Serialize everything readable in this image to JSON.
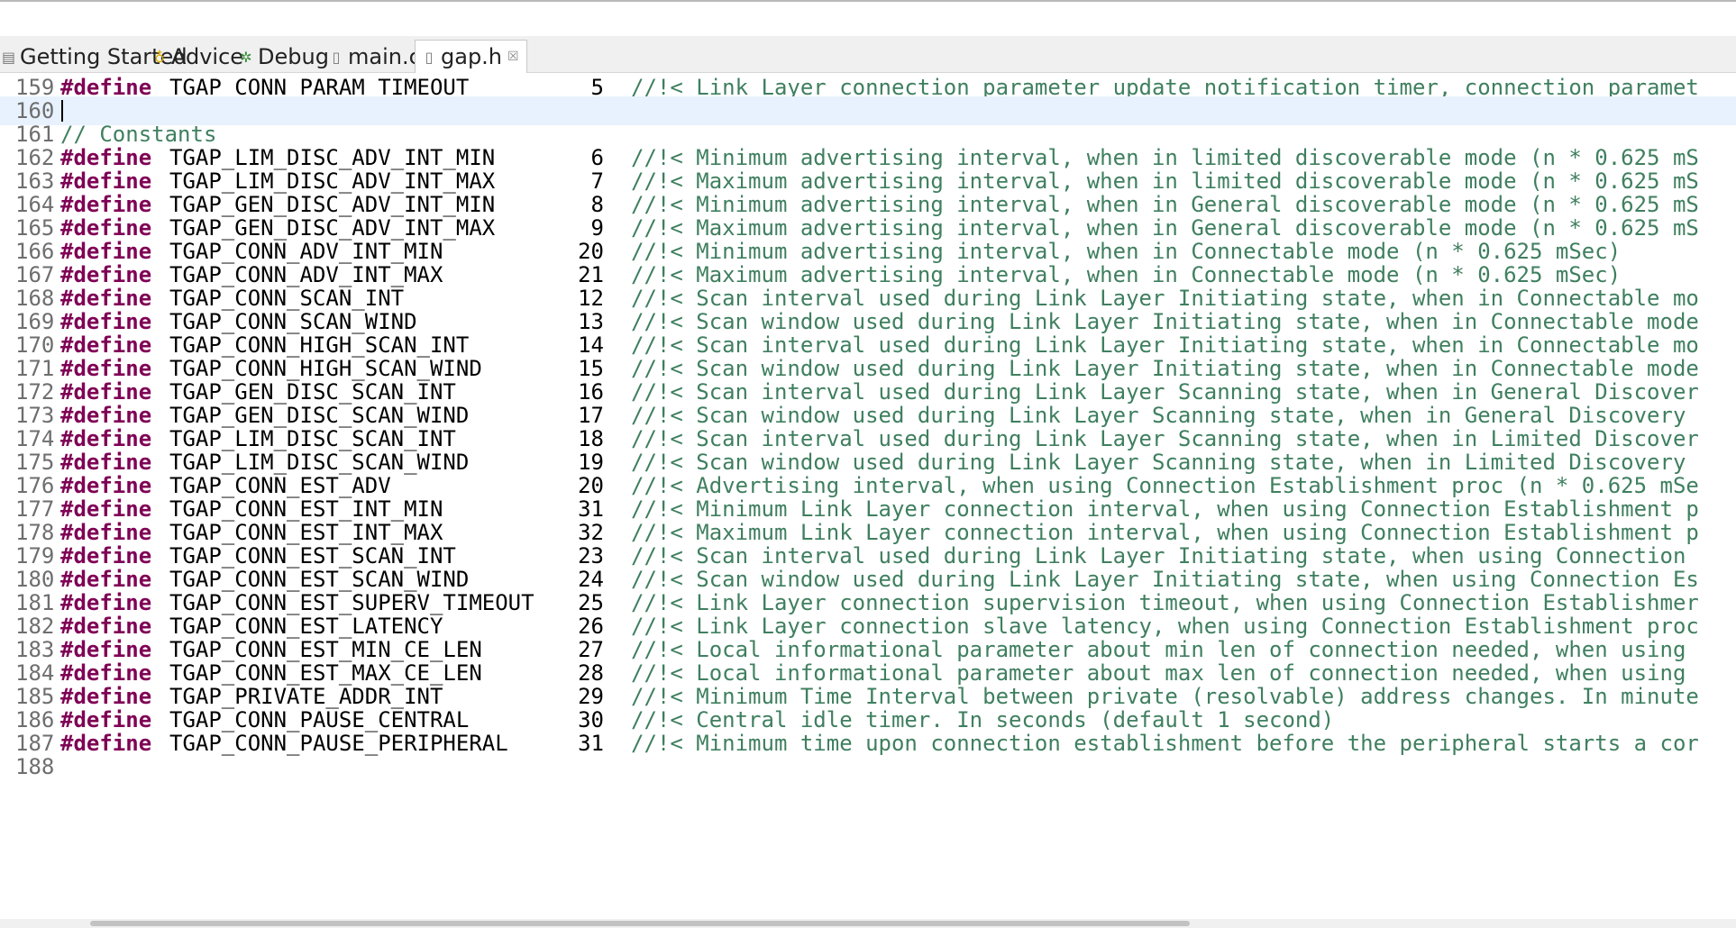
{
  "tabs": [
    {
      "label": "Getting Started",
      "icon": "page-icon"
    },
    {
      "label": "Advice",
      "icon": "lightbulb-icon"
    },
    {
      "label": "Debug",
      "icon": "debug-icon"
    },
    {
      "label": "main.c",
      "icon": "c-file-icon"
    },
    {
      "label": "gap.h",
      "icon": "h-file-icon",
      "close": "☒"
    }
  ],
  "editor": {
    "lines": [
      {
        "n": "159",
        "kw": "#define",
        "name": "TGAP_CONN_PARAM_TIMEOUT",
        "val": "5",
        "comment": "//!< Link Layer connection parameter update notification timer, connection paramet"
      },
      {
        "n": "160"
      },
      {
        "n": "161",
        "comment": "// Constants",
        "full": true
      },
      {
        "n": "162",
        "kw": "#define",
        "name": "TGAP_LIM_DISC_ADV_INT_MIN",
        "val": "6",
        "comment": "//!< Minimum advertising interval, when in limited discoverable mode (n * 0.625 mS"
      },
      {
        "n": "163",
        "kw": "#define",
        "name": "TGAP_LIM_DISC_ADV_INT_MAX",
        "val": "7",
        "comment": "//!< Maximum advertising interval, when in limited discoverable mode (n * 0.625 mS"
      },
      {
        "n": "164",
        "kw": "#define",
        "name": "TGAP_GEN_DISC_ADV_INT_MIN",
        "val": "8",
        "comment": "//!< Minimum advertising interval, when in General discoverable mode (n * 0.625 mS"
      },
      {
        "n": "165",
        "kw": "#define",
        "name": "TGAP_GEN_DISC_ADV_INT_MAX",
        "val": "9",
        "comment": "//!< Maximum advertising interval, when in General discoverable mode (n * 0.625 mS"
      },
      {
        "n": "166",
        "kw": "#define",
        "name": "TGAP_CONN_ADV_INT_MIN",
        "val": "20",
        "comment": "//!< Minimum advertising interval, when in Connectable mode (n * 0.625 mSec)"
      },
      {
        "n": "167",
        "kw": "#define",
        "name": "TGAP_CONN_ADV_INT_MAX",
        "val": "21",
        "comment": "//!< Maximum advertising interval, when in Connectable mode (n * 0.625 mSec)"
      },
      {
        "n": "168",
        "kw": "#define",
        "name": "TGAP_CONN_SCAN_INT",
        "val": "12",
        "comment": "//!< Scan interval used during Link Layer Initiating state, when in Connectable mo"
      },
      {
        "n": "169",
        "kw": "#define",
        "name": "TGAP_CONN_SCAN_WIND",
        "val": "13",
        "comment": "//!< Scan window used during Link Layer Initiating state, when in Connectable mode"
      },
      {
        "n": "170",
        "kw": "#define",
        "name": "TGAP_CONN_HIGH_SCAN_INT",
        "val": "14",
        "comment": "//!< Scan interval used during Link Layer Initiating state, when in Connectable mo"
      },
      {
        "n": "171",
        "kw": "#define",
        "name": "TGAP_CONN_HIGH_SCAN_WIND",
        "val": "15",
        "comment": "//!< Scan window used during Link Layer Initiating state, when in Connectable mode"
      },
      {
        "n": "172",
        "kw": "#define",
        "name": "TGAP_GEN_DISC_SCAN_INT",
        "val": "16",
        "comment": "//!< Scan interval used during Link Layer Scanning state, when in General Discover"
      },
      {
        "n": "173",
        "kw": "#define",
        "name": "TGAP_GEN_DISC_SCAN_WIND",
        "val": "17",
        "comment": "//!< Scan window used during Link Layer Scanning state, when in General Discovery"
      },
      {
        "n": "174",
        "kw": "#define",
        "name": "TGAP_LIM_DISC_SCAN_INT",
        "val": "18",
        "comment": "//!< Scan interval used during Link Layer Scanning state, when in Limited Discover"
      },
      {
        "n": "175",
        "kw": "#define",
        "name": "TGAP_LIM_DISC_SCAN_WIND",
        "val": "19",
        "comment": "//!< Scan window used during Link Layer Scanning state, when in Limited Discovery"
      },
      {
        "n": "176",
        "kw": "#define",
        "name": "TGAP_CONN_EST_ADV",
        "val": "20",
        "comment": "//!< Advertising interval, when using Connection Establishment proc (n * 0.625 mSe"
      },
      {
        "n": "177",
        "kw": "#define",
        "name": "TGAP_CONN_EST_INT_MIN",
        "val": "31",
        "comment": "//!< Minimum Link Layer connection interval, when using Connection Establishment p"
      },
      {
        "n": "178",
        "kw": "#define",
        "name": "TGAP_CONN_EST_INT_MAX",
        "val": "32",
        "comment": "//!< Maximum Link Layer connection interval, when using Connection Establishment p"
      },
      {
        "n": "179",
        "kw": "#define",
        "name": "TGAP_CONN_EST_SCAN_INT",
        "val": "23",
        "comment": "//!< Scan interval used during Link Layer Initiating state, when using Connection"
      },
      {
        "n": "180",
        "kw": "#define",
        "name": "TGAP_CONN_EST_SCAN_WIND",
        "val": "24",
        "comment": "//!< Scan window used during Link Layer Initiating state, when using Connection Es"
      },
      {
        "n": "181",
        "kw": "#define",
        "name": "TGAP_CONN_EST_SUPERV_TIMEOUT",
        "val": "25",
        "comment": "//!< Link Layer connection supervision timeout, when using Connection Establishmer"
      },
      {
        "n": "182",
        "kw": "#define",
        "name": "TGAP_CONN_EST_LATENCY",
        "val": "26",
        "comment": "//!< Link Layer connection slave latency, when using Connection Establishment proc"
      },
      {
        "n": "183",
        "kw": "#define",
        "name": "TGAP_CONN_EST_MIN_CE_LEN",
        "val": "27",
        "comment": "//!< Local informational parameter about min len of connection needed, when using"
      },
      {
        "n": "184",
        "kw": "#define",
        "name": "TGAP_CONN_EST_MAX_CE_LEN",
        "val": "28",
        "comment": "//!< Local informational parameter about max len of connection needed, when using"
      },
      {
        "n": "185",
        "kw": "#define",
        "name": "TGAP_PRIVATE_ADDR_INT",
        "val": "29",
        "comment": "//!< Minimum Time Interval between private (resolvable) address changes. In minute"
      },
      {
        "n": "186",
        "kw": "#define",
        "name": "TGAP_CONN_PAUSE_CENTRAL",
        "val": "30",
        "comment": "//!< Central idle timer. In seconds (default 1 second)"
      },
      {
        "n": "187",
        "kw": "#define",
        "name": "TGAP_CONN_PAUSE_PERIPHERAL",
        "val": "31",
        "comment": "//!< Minimum time upon connection establishment before the peripheral starts a cor"
      },
      {
        "n": "188"
      }
    ]
  },
  "colors": {
    "keyword": "#7f0055",
    "comment": "#3f7f5f",
    "line_number": "#6e6e6e",
    "current_line": "#e8f2fe"
  }
}
